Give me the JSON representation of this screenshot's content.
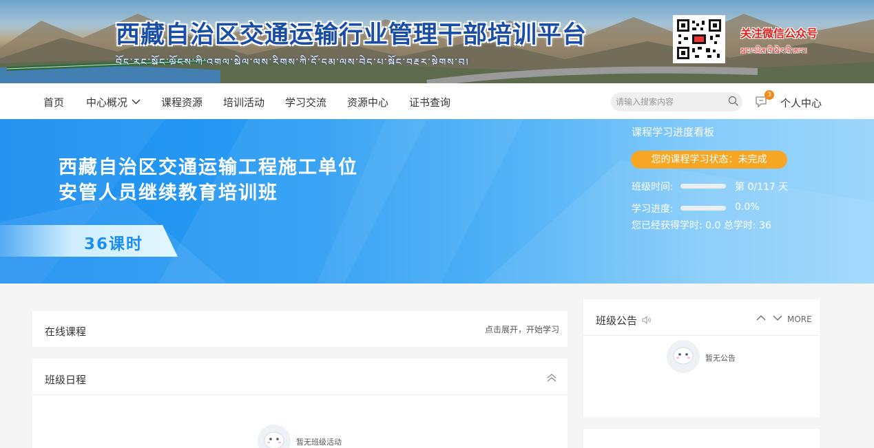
{
  "header": {
    "title": "西藏自治区交通运输行业管理干部培训平台",
    "subtitle": "བོད་རང་སྐྱོང་ལྗོངས་ཀྱི་འགྲུལ་སྐྱེལ་ལས་རིགས་ཀྱི་དོ་དམ་ལས་བྱེད་པ་སྦྱོང་བརྡར་སྟེགས་བུ།",
    "wechat_title": "关注微信公众号",
    "wechat_subtitle": "སྐད་འཕྲིན་གྱི་སྒེར་གྱི་ཨང་།",
    "qr_code_alt": "qr-code"
  },
  "nav": {
    "items": [
      {
        "label": "首页"
      },
      {
        "label": "中心概况",
        "has_dropdown": true
      },
      {
        "label": "课程资源"
      },
      {
        "label": "培训活动"
      },
      {
        "label": "学习交流"
      },
      {
        "label": "资源中心"
      },
      {
        "label": "证书查询"
      }
    ],
    "search_placeholder": "请输入搜索内容",
    "message_count": "3",
    "personal_center": "个人中心"
  },
  "hero": {
    "title_line1": "西藏自治区交通运输工程施工单位",
    "title_line2": "安管人员继续教育培训班",
    "hours_badge": "36课时",
    "board": {
      "title": "课程学习进度看板",
      "status": "您的课程学习状态：未完成",
      "class_time_label": "班级时间:",
      "class_time_value": "第 0/117 天",
      "class_time_progress": 0,
      "progress_label": "学习进度:",
      "progress_value": "0.0%",
      "progress_fraction": 0,
      "hours_summary": "您已经获得学时: 0.0 总学时: 36"
    }
  },
  "online_courses": {
    "title": "在线课程",
    "action": "点击展开，开始学习"
  },
  "schedule": {
    "title": "班级日程",
    "empty": "暂无班级活动"
  },
  "announcements": {
    "title": "班级公告",
    "more": "MORE",
    "empty": "暂无公告"
  },
  "colors": {
    "accent_blue": "#1d8df0",
    "status_orange": "#f6a623",
    "title_blue": "#1a4ea6",
    "wechat_red": "#e2211c"
  }
}
